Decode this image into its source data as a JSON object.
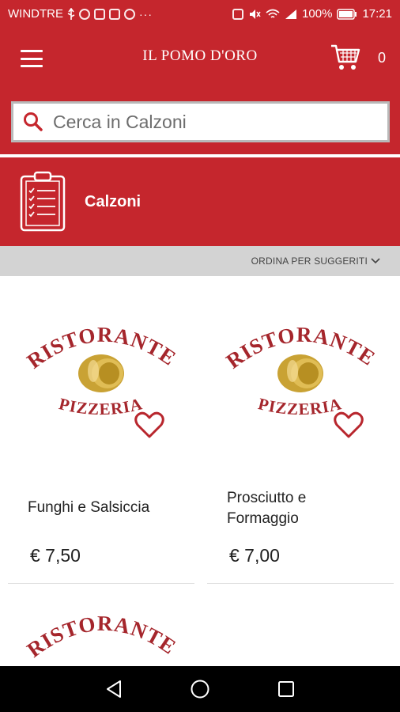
{
  "status_bar": {
    "carrier": "WINDTRE",
    "battery": "100%",
    "time": "17:21",
    "icons": [
      "usb-icon",
      "facebook-icon",
      "calendar-icon",
      "instagram-icon",
      "messenger-icon",
      "more-icon",
      "nfc-icon",
      "mute-icon",
      "wifi-icon",
      "signal-icon",
      "battery-icon"
    ]
  },
  "app_bar": {
    "title": "IL POMO D'ORO",
    "cart_count": "0",
    "icons": [
      "menu-icon",
      "cart-icon"
    ]
  },
  "search": {
    "placeholder": "Cerca in Calzoni",
    "value": "",
    "icon": "search-icon"
  },
  "category": {
    "title": "Calzoni",
    "icon": "clipboard-checklist-icon"
  },
  "sort": {
    "label": "ORDINA PER SUGGERITI",
    "icon": "chevron-down-icon"
  },
  "products": [
    {
      "name": "Funghi e Salsiccia",
      "price": "€ 7,50",
      "logo_text": [
        "RISTORANTE",
        "PIZZERIA"
      ]
    },
    {
      "name": "Prosciutto e Formaggio",
      "price": "€ 7,00",
      "logo_text": [
        "RISTORANTE",
        "PIZZERIA"
      ]
    },
    {
      "name": "",
      "price": "",
      "logo_text": [
        "RISTORANTE",
        ""
      ]
    }
  ],
  "nav_bar": {
    "icons": [
      "back-icon",
      "home-icon",
      "recents-icon"
    ]
  },
  "colors": {
    "brand_red": "#c5262d",
    "sort_bar_gray": "#d3d3d3",
    "logo_red": "#a5262c",
    "logo_gold": "#c9a234"
  }
}
